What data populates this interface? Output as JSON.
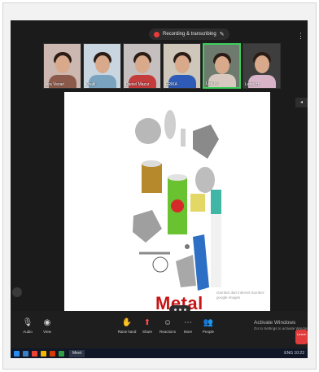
{
  "meeting": {
    "recording_label": "Recording & transcribing",
    "more_icon": "more-vert-icon",
    "pin_icon": "pencil-icon"
  },
  "participants": [
    {
      "name": "Ara Vezari",
      "torso_color": "#8c5a4a",
      "bg": "#ccb8b0",
      "active": false
    },
    {
      "name": "Khalil",
      "torso_color": "#7aa3c0",
      "bg": "#c9d6e0",
      "active": false
    },
    {
      "name": "Daniel Mazur",
      "torso_color": "#c33b3b",
      "bg": "#c6bfc0",
      "active": false
    },
    {
      "name": "ERIKA",
      "torso_color": "#2e5ab8",
      "bg": "#cfc7b9",
      "active": false
    },
    {
      "name": "Lee W.",
      "torso_color": "#d8c9c0",
      "bg": "#6d7a6d",
      "active": true
    },
    {
      "name": "Lenis H.",
      "torso_color": "#d7b4c8",
      "bg": "#3e3e3e",
      "active": false
    }
  ],
  "slide": {
    "title": "Metal",
    "note": "Gambar dari internet Sumber: google images"
  },
  "toolbar": {
    "left_tools": [
      {
        "icon": "mic-icon",
        "label": "Audio"
      },
      {
        "icon": "eye-icon",
        "label": "View"
      }
    ],
    "center_tools": [
      {
        "icon": "raise-hand-icon",
        "label": "Raise hand"
      },
      {
        "icon": "share-screen-icon",
        "label": "Share"
      },
      {
        "icon": "reactions-icon",
        "label": "Reactions"
      },
      {
        "icon": "more-icon",
        "label": "More"
      },
      {
        "icon": "participants-icon",
        "label": "People"
      }
    ],
    "leave_label": "Leave"
  },
  "activate_windows": {
    "title": "Activate Windows",
    "subtitle": "Go to Settings to activate Windows."
  },
  "taskbar": {
    "app_label": "Meet",
    "tray_text": "ENG 10:22"
  },
  "colors": {
    "slide_title": "#c81414",
    "active_tile": "#3ccf5b",
    "leave_button": "#e03c3c"
  }
}
